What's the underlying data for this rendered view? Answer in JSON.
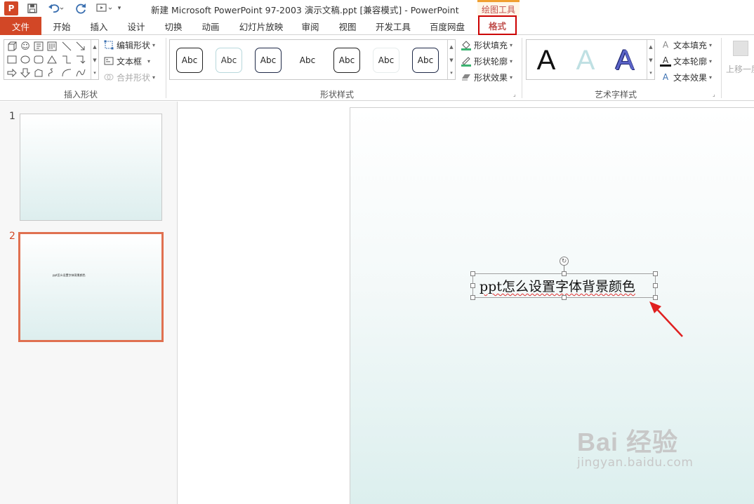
{
  "titlebar": {
    "title": "新建 Microsoft PowerPoint 97-2003 演示文稿.ppt [兼容模式] - PowerPoint",
    "contextual_tab_group": "绘图工具",
    "app_icon_letter": "P"
  },
  "tabs": [
    "文件",
    "开始",
    "插入",
    "设计",
    "切换",
    "动画",
    "幻灯片放映",
    "审阅",
    "视图",
    "开发工具",
    "百度网盘",
    "格式"
  ],
  "ribbon": {
    "insert_shapes": {
      "label": "插入形状",
      "edit_shape": "编辑形状",
      "text_box": "文本框",
      "merge_shapes": "合并形状"
    },
    "shape_styles": {
      "label": "形状样式",
      "preset_text": "Abc",
      "shape_fill": "形状填充",
      "shape_outline": "形状轮廓",
      "shape_effects": "形状效果"
    },
    "wordart_styles": {
      "label": "艺术字样式",
      "sample": "A",
      "text_fill": "文本填充",
      "text_outline": "文本轮廓",
      "text_effects": "文本效果"
    },
    "arrange": {
      "bring_forward": "上移一层"
    }
  },
  "thumbnails": [
    {
      "number": "1",
      "text": ""
    },
    {
      "number": "2",
      "text": "ppt怎么设置字体背景颜色"
    }
  ],
  "slide": {
    "textbox_text": "ppt怎么设置字体背景颜色"
  },
  "watermark": {
    "main": "Bai 经验",
    "sub": "jingyan.baidu.com"
  },
  "colors": {
    "accent": "#d24726",
    "highlight_border": "#cc0000",
    "arrow": "#e02020",
    "contextual": "#f0a030"
  }
}
